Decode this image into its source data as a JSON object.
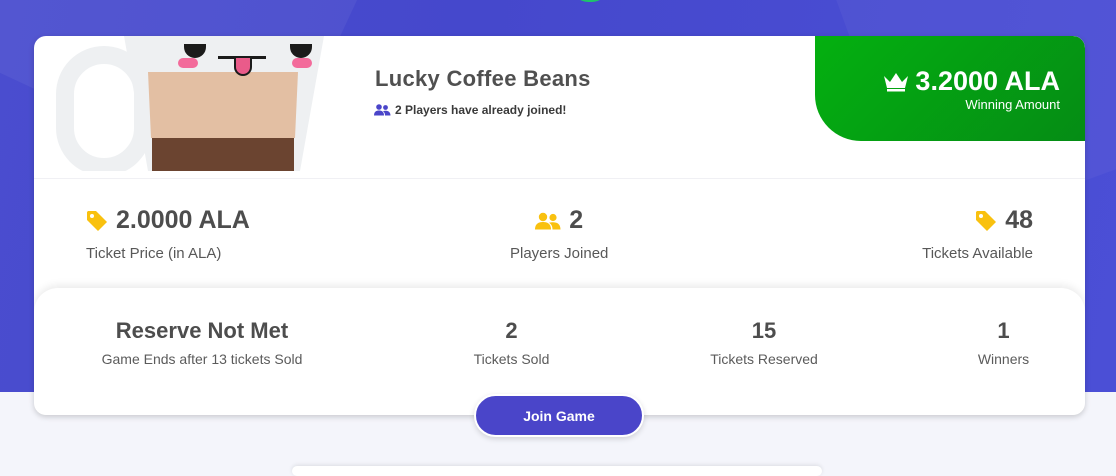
{
  "game": {
    "title": "Lucky Coffee Beans",
    "joined_text": "2 Players have already joined!"
  },
  "winning": {
    "amount": "3.2000 ALA",
    "label": "Winning Amount"
  },
  "stats": {
    "ticket_price_value": "2.0000 ALA",
    "ticket_price_label": "Ticket Price (in ALA)",
    "players_value": "2",
    "players_label": "Players Joined",
    "tickets_available_value": "48",
    "tickets_available_label": "Tickets Available"
  },
  "bottom": {
    "reserve_value": "Reserve Not Met",
    "reserve_label": "Game Ends after 13 tickets Sold",
    "sold_value": "2",
    "sold_label": "Tickets Sold",
    "reserved_value": "15",
    "reserved_label": "Tickets Reserved",
    "winners_value": "1",
    "winners_label": "Winners"
  },
  "actions": {
    "join_label": "Join Game"
  },
  "icons": {
    "tag": "tag-icon",
    "users": "users-icon",
    "crown": "crown-icon"
  },
  "colors": {
    "brand": "#4a45c9",
    "win_green": "#05a312",
    "icon_yellow": "#f9c10f"
  }
}
